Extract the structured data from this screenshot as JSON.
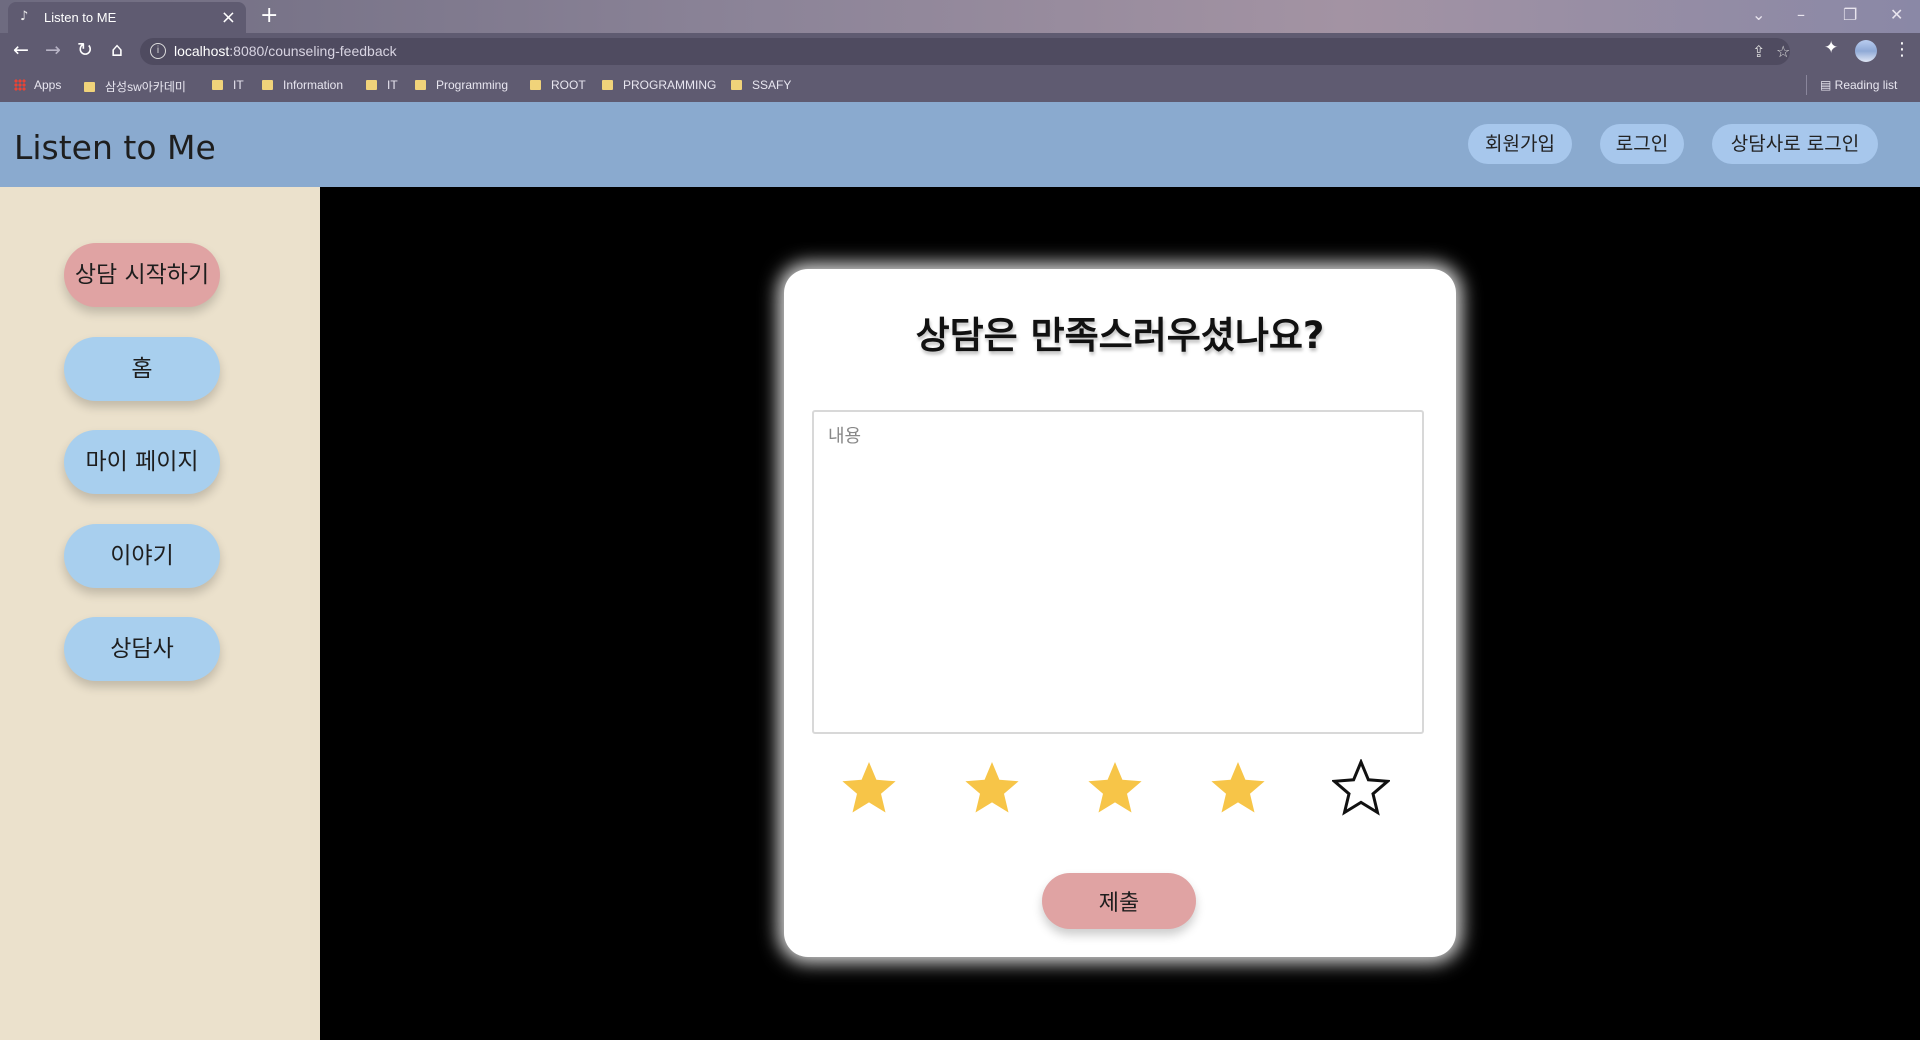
{
  "browser": {
    "tab_title": "Listen to ME",
    "tab_close": "×",
    "new_tab": "+",
    "url_host": "localhost",
    "url_path": ":8080/counseling-feedback",
    "bookmarks": [
      "Apps",
      "삼성sw아카데미",
      "IT",
      "Information",
      "IT",
      "Programming",
      "ROOT",
      "PROGRAMMING",
      "SSAFY"
    ],
    "reading_list": "Reading list"
  },
  "header": {
    "title": "Listen to Me",
    "signup": "회원가입",
    "login": "로그인",
    "counselor_login": "상담사로 로그인"
  },
  "sidebar": {
    "items": [
      {
        "label": "상담 시작하기"
      },
      {
        "label": "홈"
      },
      {
        "label": "마이 페이지"
      },
      {
        "label": "이야기"
      },
      {
        "label": "상담사"
      }
    ]
  },
  "feedback": {
    "question": "상담은 만족스러우셨나요?",
    "content_placeholder": "내용",
    "content_value": "",
    "rating": 4,
    "rating_max": 5,
    "submit": "제출"
  },
  "colors": {
    "header": "#8aaacf",
    "sidebar": "#ebe1cc",
    "pill_blue": "#a8cfee",
    "pill_pink": "#e0a3a3",
    "star_filled": "#f7c548"
  }
}
